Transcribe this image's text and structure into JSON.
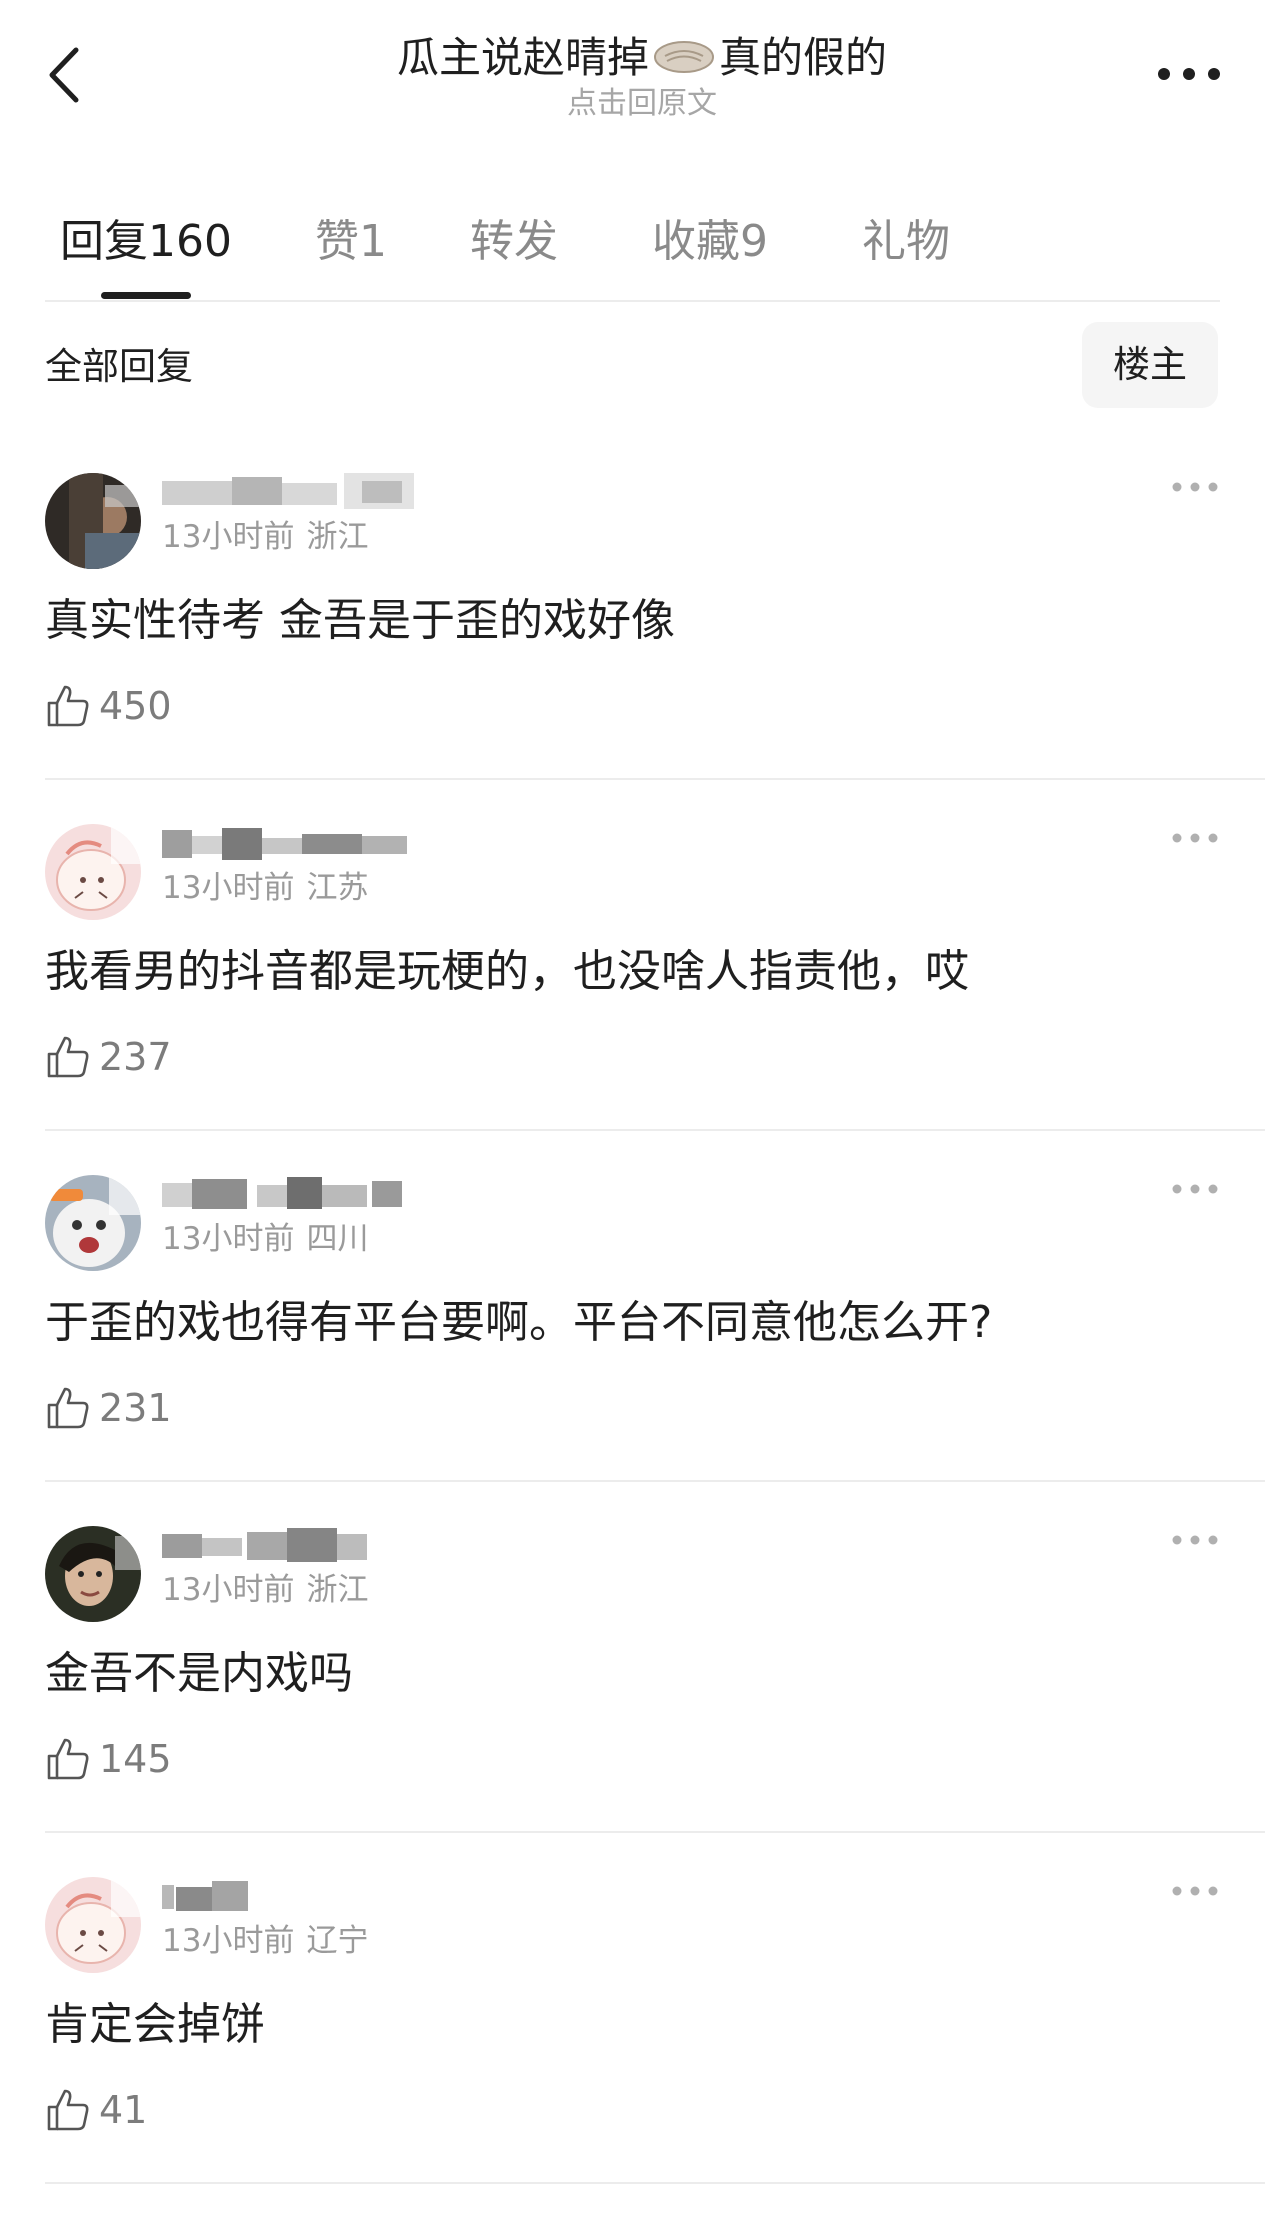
{
  "nav": {
    "title_before": "瓜主说赵晴掉",
    "title_icon": "bun-icon",
    "title_after": "真的假的",
    "subtitle": "点击回原文"
  },
  "tabs": [
    {
      "label": "回复",
      "count": "160",
      "active": true
    },
    {
      "label": "赞",
      "count": "1"
    },
    {
      "label": "转发",
      "count": ""
    },
    {
      "label": "收藏",
      "count": "9"
    },
    {
      "label": "礼物",
      "count": ""
    }
  ],
  "section": {
    "title": "全部回复",
    "owner_filter_label": "楼主"
  },
  "comments": [
    {
      "time": "13小时前",
      "location": "浙江",
      "text": "真实性待考 金吾是于歪的戏好像",
      "likes": "450"
    },
    {
      "time": "13小时前",
      "location": "江苏",
      "text": "我看男的抖音都是玩梗的，也没啥人指责他，哎",
      "likes": "237"
    },
    {
      "time": "13小时前",
      "location": "四川",
      "text": "于歪的戏也得有平台要啊。平台不同意他怎么开?",
      "likes": "231"
    },
    {
      "time": "13小时前",
      "location": "浙江",
      "text": "金吾不是内戏吗",
      "likes": "145"
    },
    {
      "time": "13小时前",
      "location": "辽宁",
      "text": "肯定会掉饼",
      "likes": "41"
    }
  ],
  "colors": {
    "text_primary": "#1f1f1f",
    "text_secondary": "#9a9a9a",
    "divider": "#ececec",
    "button_bg": "#f5f5f5"
  }
}
